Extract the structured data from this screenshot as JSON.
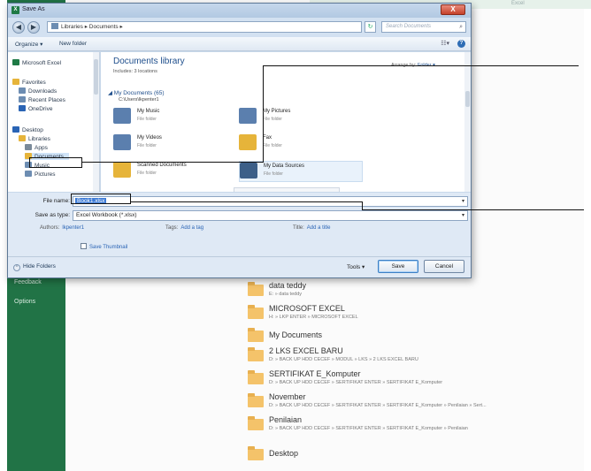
{
  "backstage": {
    "sidebar": [
      {
        "label": "Feedback"
      },
      {
        "label": "Options"
      }
    ],
    "top_text": "Excel",
    "recent_folders": [
      {
        "name": "data teddy",
        "path": "E: » data teddy"
      },
      {
        "name": "MICROSOFT EXCEL",
        "path": "H: » LKP ENTER » MICROSOFT EXCEL"
      },
      {
        "name": "My Documents",
        "path": ""
      },
      {
        "name": "2 LKS EXCEL BARU",
        "path": "D: » BACK UP HDD CECEF » MODUL » LKS » 2 LKS EXCEL BARU"
      },
      {
        "name": "SERTIFIKAT E_Komputer",
        "path": "D: » BACK UP HDD CECEF » SERTIFIKAT ENTER » SERTIFIKAT E_Komputer"
      },
      {
        "name": "November",
        "path": "D: » BACK UP HDD CECEF » SERTIFIKAT ENTER » SERTIFIKAT E_Komputer » Penilaian » Sert..."
      },
      {
        "name": "Penilaian",
        "path": "D: » BACK UP HDD CECEF » SERTIFIKAT ENTER » SERTIFIKAT E_Komputer » Penilaian"
      },
      {
        "name": "Desktop",
        "path": ""
      }
    ]
  },
  "dialog": {
    "title": "Save As",
    "close_label": "X",
    "address": "Libraries ▸ Documents ▸",
    "search_placeholder": "Search Documents",
    "search_icon": "search-icon",
    "commands": {
      "organize": "Organize ▾",
      "new_folder": "New folder"
    },
    "nav_pane": [
      {
        "label": "Microsoft Excel",
        "icon": "excel-icon",
        "color": "#1f7a45"
      },
      {
        "label": "Favorites",
        "icon": "star-icon",
        "color": "#e6b43a"
      },
      {
        "label": "Downloads",
        "icon": "downloads-icon",
        "color": "#6d8db2"
      },
      {
        "label": "Recent Places",
        "icon": "recent-places-icon",
        "color": "#6d8db2"
      },
      {
        "label": "OneDrive",
        "icon": "cloud-icon",
        "color": "#2a64b5"
      },
      {
        "label": "Desktop",
        "icon": "desktop-icon",
        "color": "#2a64b5"
      },
      {
        "label": "Libraries",
        "icon": "libraries-icon",
        "color": "#e6b43a"
      },
      {
        "label": "Apps",
        "icon": "apps-icon",
        "color": "#7a8a9a"
      },
      {
        "label": "Documents",
        "icon": "documents-icon",
        "color": "#e6b43a"
      },
      {
        "label": "Music",
        "icon": "music-icon",
        "color": "#6d8db2"
      },
      {
        "label": "Pictures",
        "icon": "pictures-icon",
        "color": "#6d8db2"
      }
    ],
    "library_title": "Documents library",
    "library_subtitle": "Includes: 3 locations",
    "arrange_label": "Arrange by:",
    "arrange_value": "Folder ▾",
    "group_header": "◢ My Documents (65)",
    "group_path": "C:\\Users\\lkpenter1",
    "files": [
      {
        "name": "My Music",
        "type": "File folder",
        "icon": "music-folder-icon",
        "color": "#5b7fae"
      },
      {
        "name": "My Pictures",
        "type": "File folder",
        "icon": "pictures-folder-icon",
        "color": "#5b7fae"
      },
      {
        "name": "My Videos",
        "type": "File folder",
        "icon": "videos-folder-icon",
        "color": "#5b7fae"
      },
      {
        "name": "Fax",
        "type": "File folder",
        "icon": "fax-folder-icon",
        "color": "#e6b43a"
      },
      {
        "name": "Scanned Documents",
        "type": "File folder",
        "icon": "scanned-folder-icon",
        "color": "#e6b43a"
      },
      {
        "name": "My Data Sources",
        "type": "File folder",
        "icon": "data-sources-folder-icon",
        "color": "#3c5f88"
      }
    ],
    "file_name_label": "File name:",
    "file_name_value": "Book1.xlsx",
    "save_type_label": "Save as type:",
    "save_type_value": "Excel Workbook (*.xlsx)",
    "authors_label": "Authors:",
    "authors_value": "lkpenter1",
    "tags_label": "Tags:",
    "tags_value": "Add a tag",
    "title_label": "Title:",
    "title_value": "Add a title",
    "thumbnail_label": "Save Thumbnail",
    "hide_folders_label": "Hide Folders",
    "tools_label": "Tools ▾",
    "save_label": "Save",
    "cancel_label": "Cancel"
  }
}
